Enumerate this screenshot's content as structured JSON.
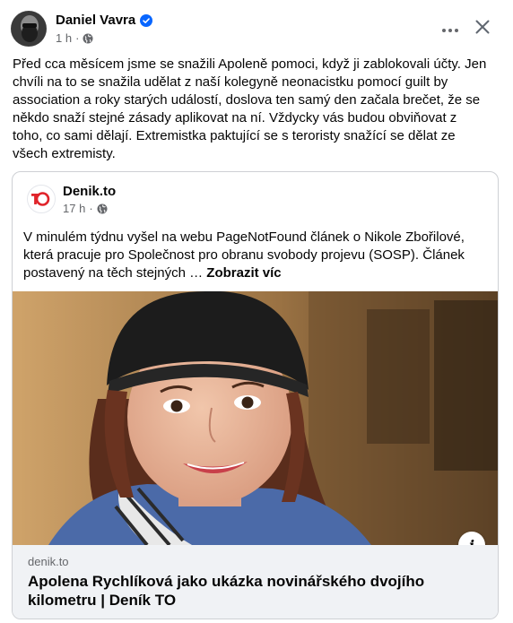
{
  "post": {
    "author": "Daniel Vavra",
    "time": "1 h",
    "separator": "·",
    "text": "Před cca měsícem jsme se snažili Apoleně pomoci, když ji zablokovali účty. Jen chvíli na to se snažila udělat z naší kolegyně neonacistku pomocí guilt by association a roky starých událostí, doslova ten samý den začala brečet, že se někdo snaží stejné zásady aplikovat na ní. Vždycky vás budou obviňovat z toho, co sami dělají. Extremistka paktující se s teroristy snažící se dělat ze všech extremisty."
  },
  "icons": {
    "verified": "verified-badge-icon",
    "globe": "globe-icon",
    "more": "more-options-icon",
    "close": "close-icon",
    "info": "info-icon"
  },
  "shared": {
    "source_name": "Denik.to",
    "logo_text": "TO",
    "time": "17 h",
    "separator": "·",
    "text": "V minulém týdnu vyšel na webu PageNotFound článek o Nikole Zbořilové, která pracuje pro Společnost pro obranu svobody projevu (SOSP). Článek postavený na těch stejných …",
    "see_more": "Zobrazit víc",
    "info_label": "i",
    "link": {
      "domain": "denik.to",
      "title": "Apolena Rychlíková jako ukázka novinářského dvojího kilometru | Deník TO"
    }
  },
  "colors": {
    "verified_blue": "#0866ff",
    "secondary_text": "#65676b",
    "logo_red": "#e0242a",
    "footer_bg": "#f0f2f5"
  }
}
